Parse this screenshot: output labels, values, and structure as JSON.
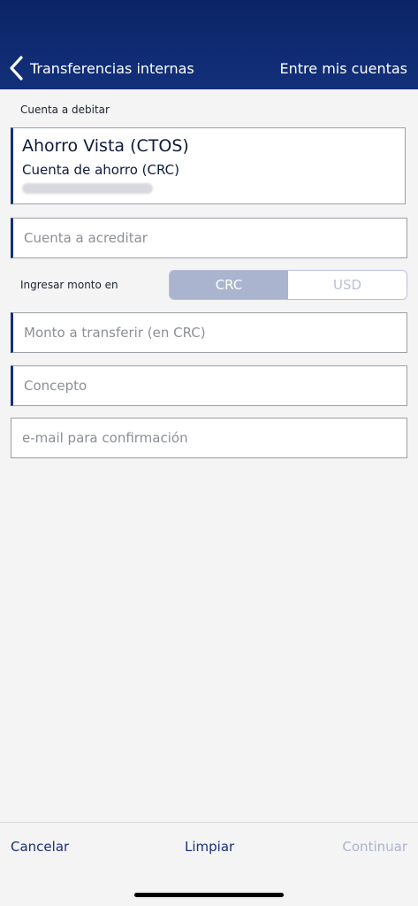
{
  "header": {
    "back_label": "Transferencias internas",
    "right_label": "Entre mis cuentas"
  },
  "debit": {
    "label": "Cuenta a debitar",
    "account_name": "Ahorro Vista (CTOS)",
    "account_type": "Cuenta de ahorro (CRC)"
  },
  "fields": {
    "credit_account_placeholder": "Cuenta a acreditar",
    "amount_placeholder": "Monto a transferir (en CRC)",
    "concept_placeholder": "Concepto",
    "email_placeholder": "e-mail para confirmación"
  },
  "amount_currency": {
    "label": "Ingresar monto en",
    "options": [
      "CRC",
      "USD"
    ],
    "selected": "CRC"
  },
  "footer": {
    "cancel_label": "Cancelar",
    "clear_label": "Limpiar",
    "continue_label": "Continuar"
  },
  "colors": {
    "header_bg": "#0b2466",
    "accent": "#16307a",
    "segment_active": "#aab4cf",
    "disabled_text": "#aab4cf"
  }
}
